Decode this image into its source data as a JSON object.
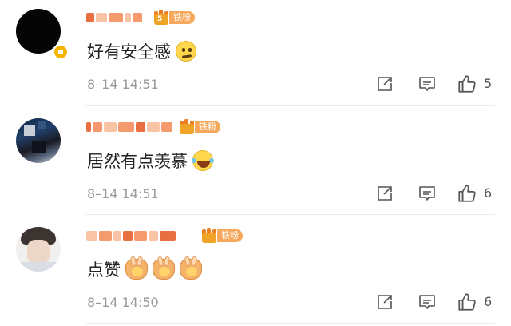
{
  "comments": [
    {
      "fan_badge": "铁粉",
      "fan_level": "5",
      "text": "好有安全感",
      "emoji": "thinking-face-emoji",
      "time": "8–14 14:51",
      "likes": "5"
    },
    {
      "fan_badge": "铁粉",
      "fan_level": "",
      "text": "居然有点羡慕",
      "emoji": "tears-of-joy-emoji",
      "time": "8–14 14:51",
      "likes": "6"
    },
    {
      "fan_badge": "铁粉",
      "fan_level": "",
      "text": "点赞",
      "emoji": "praying-hands-emoji",
      "time": "8–14 14:50",
      "likes": "6"
    }
  ],
  "icons": {
    "share": "share-icon",
    "reply": "comment-icon",
    "like": "thumbs-up-icon",
    "verified": "verified-badge-icon",
    "crown": "crown-icon"
  },
  "colors": {
    "accent": "#f6a85c",
    "timestamp": "#999999",
    "text": "#222222",
    "divider": "#ececec"
  }
}
